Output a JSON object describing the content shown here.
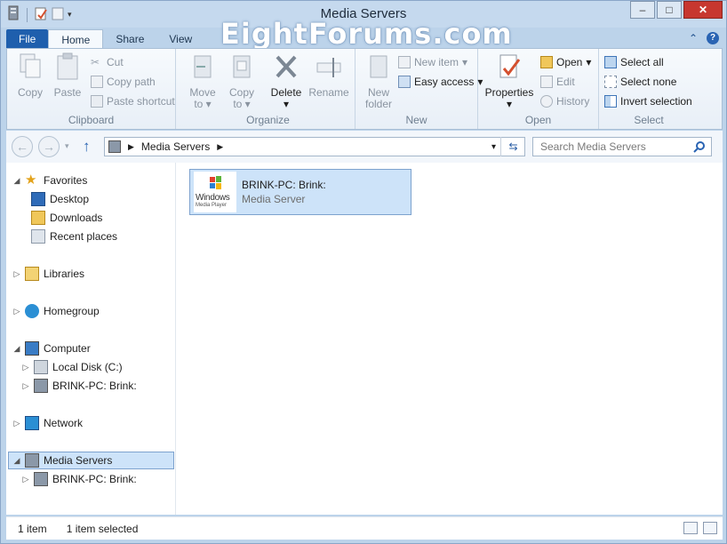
{
  "window": {
    "title": "Media Servers",
    "watermark": "EightForums.com"
  },
  "window_controls": {
    "minimize": "–",
    "maximize": "□",
    "close": "✕"
  },
  "ribbon_tabs": [
    {
      "label": "File"
    },
    {
      "label": "Home"
    },
    {
      "label": "Share"
    },
    {
      "label": "View"
    }
  ],
  "ribbon": {
    "clipboard": {
      "label": "Clipboard",
      "copy": "Copy",
      "paste": "Paste",
      "cut": "Cut",
      "copy_path": "Copy path",
      "paste_shortcut": "Paste shortcut"
    },
    "organize": {
      "label": "Organize",
      "move_to_1": "Move",
      "move_to_2": "to",
      "copy_to_1": "Copy",
      "copy_to_2": "to",
      "delete": "Delete",
      "rename": "Rename"
    },
    "new": {
      "label": "New",
      "new_folder_1": "New",
      "new_folder_2": "folder",
      "new_item": "New item",
      "easy_access": "Easy access"
    },
    "open": {
      "label": "Open",
      "properties": "Properties",
      "open": "Open",
      "edit": "Edit",
      "history": "History"
    },
    "select": {
      "label": "Select",
      "select_all": "Select all",
      "select_none": "Select none",
      "invert_selection": "Invert selection"
    }
  },
  "address": {
    "path": "Media Servers",
    "search_placeholder": "Search Media Servers"
  },
  "nav": {
    "favorites": "Favorites",
    "desktop": "Desktop",
    "downloads": "Downloads",
    "recent_places": "Recent places",
    "libraries": "Libraries",
    "homegroup": "Homegroup",
    "computer": "Computer",
    "local_disk": "Local Disk (C:)",
    "brink_pc_1": "BRINK-PC: Brink:",
    "network": "Network",
    "media_servers": "Media Servers",
    "brink_pc_2": "BRINK-PC: Brink:"
  },
  "content": {
    "item_title": "BRINK-PC: Brink:",
    "item_subtitle": "Media Server",
    "wmp_line1": "Windows",
    "wmp_line2": "Media Player"
  },
  "status": {
    "count": "1 item",
    "selected": "1 item selected"
  }
}
